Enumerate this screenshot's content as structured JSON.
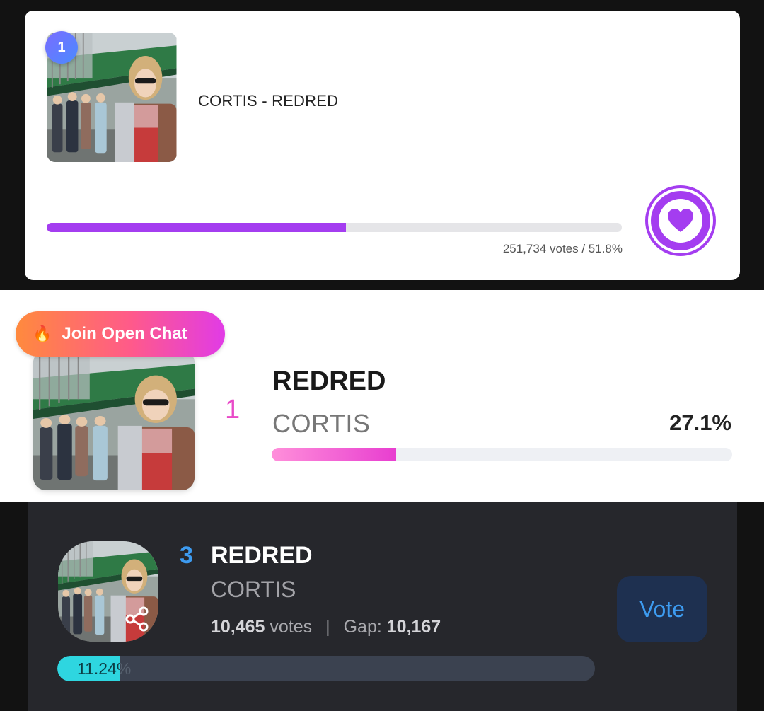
{
  "panel1": {
    "rank": "1",
    "title": "CORTIS - REDRED",
    "votes_text": "251,734 votes / 51.8%",
    "progress": 0.52,
    "accent": "#a43df0"
  },
  "panel2": {
    "chat_label": "Join Open Chat",
    "chat_icon": "fire-icon",
    "rank": "1",
    "title": "REDRED",
    "artist": "CORTIS",
    "percent": "27.1%",
    "progress": 0.271,
    "accent": "#e83ed0"
  },
  "panel3": {
    "rank": "3",
    "title": "REDRED",
    "artist": "CORTIS",
    "votes": "10,465",
    "votes_label": "votes",
    "gap_label": "Gap:",
    "gap": "10,167",
    "vote_button": "Vote",
    "percent": "11.24%",
    "progress": 0.1124,
    "accent": "#2ed6e0"
  }
}
